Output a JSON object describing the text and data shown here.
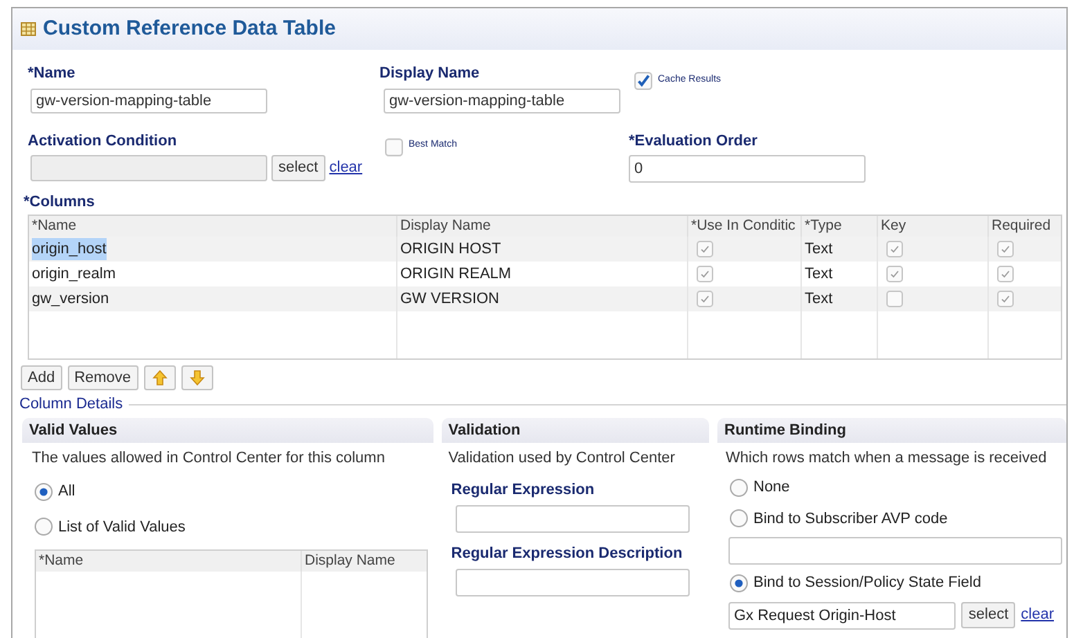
{
  "title": "Custom Reference Data Table",
  "form": {
    "name": {
      "label": "*Name",
      "value": "gw-version-mapping-table"
    },
    "display_name": {
      "label": "Display Name",
      "value": "gw-version-mapping-table"
    },
    "cache_results": {
      "label": "Cache Results",
      "checked": true
    },
    "activation_condition": {
      "label": "Activation Condition",
      "select": "select",
      "clear": "clear"
    },
    "best_match": {
      "label": "Best Match",
      "checked": false
    },
    "evaluation_order": {
      "label": "*Evaluation Order",
      "value": "0"
    }
  },
  "columns": {
    "label": "*Columns",
    "headers": [
      "*Name",
      "Display Name",
      "*Use In Conditic",
      "*Type",
      "Key",
      "Required"
    ],
    "rows": [
      {
        "name": "origin_host",
        "display_name": "ORIGIN HOST",
        "use_in_condition": true,
        "type": "Text",
        "key": true,
        "required": true,
        "selected": true
      },
      {
        "name": "origin_realm",
        "display_name": "ORIGIN REALM",
        "use_in_condition": true,
        "type": "Text",
        "key": true,
        "required": true,
        "selected": false
      },
      {
        "name": "gw_version",
        "display_name": "GW VERSION",
        "use_in_condition": true,
        "type": "Text",
        "key": false,
        "required": true,
        "selected": false
      }
    ],
    "buttons": [
      "Add",
      "Remove"
    ]
  },
  "column_details": {
    "label": "Column Details",
    "valid_values": {
      "title": "Valid Values",
      "description": "The values allowed in Control Center for this column",
      "options": [
        {
          "label": "All",
          "selected": true
        },
        {
          "label": "List of Valid Values",
          "selected": false
        }
      ],
      "table_headers": [
        "*Name",
        "Display Name"
      ]
    },
    "validation": {
      "title": "Validation",
      "description": "Validation used by Control Center",
      "fields": [
        {
          "label": "Regular Expression"
        },
        {
          "label": "Regular Expression Description"
        }
      ]
    },
    "runtime_binding": {
      "title": "Runtime Binding",
      "description": "Which rows match when a message is received",
      "options": [
        {
          "label": "None",
          "selected": false,
          "field": {
            "kind": "none"
          }
        },
        {
          "label": "Bind to Subscriber AVP code",
          "selected": false,
          "field": {
            "kind": "text"
          }
        },
        {
          "label": "Bind to Session/Policy State Field",
          "selected": true,
          "field": {
            "kind": "picker",
            "value": "Gx Request Origin-Host",
            "select": "select",
            "clear": "clear"
          }
        }
      ]
    }
  }
}
